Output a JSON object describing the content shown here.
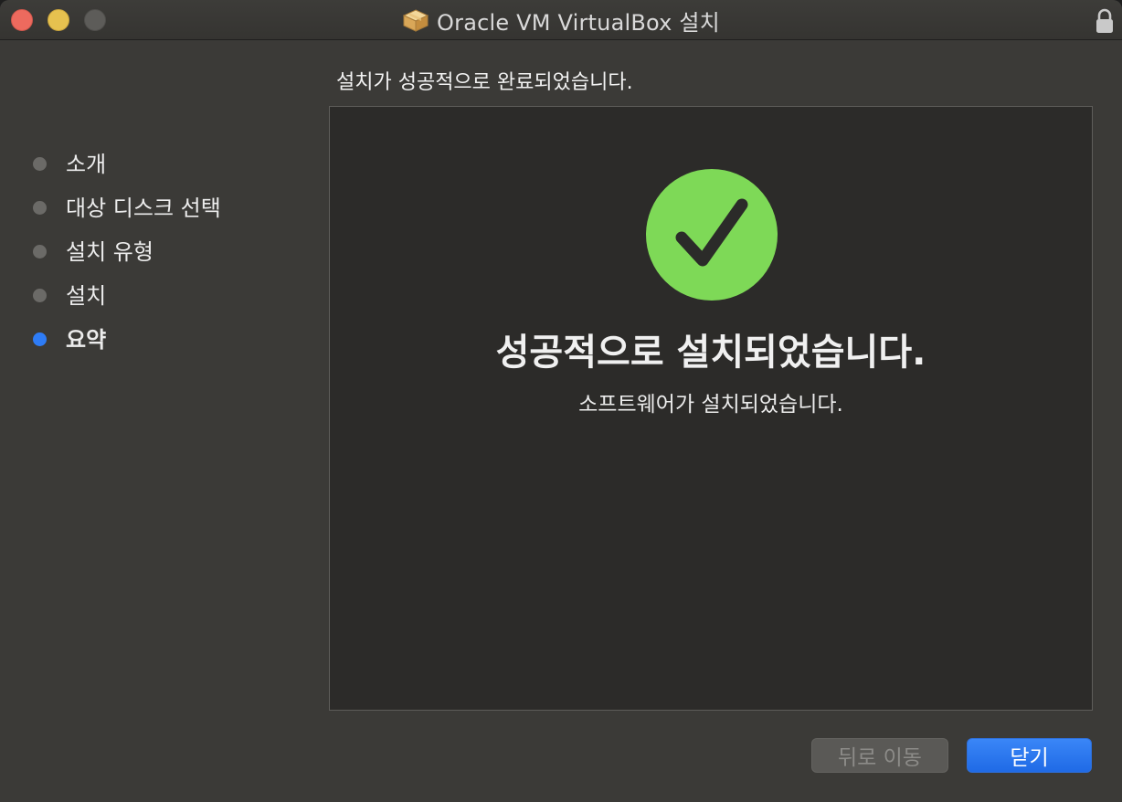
{
  "window": {
    "title": "Oracle VM VirtualBox 설치",
    "icon": "package-icon"
  },
  "sidebar": {
    "items": [
      {
        "label": "소개",
        "active": false
      },
      {
        "label": "대상 디스크 선택",
        "active": false
      },
      {
        "label": "설치 유형",
        "active": false
      },
      {
        "label": "설치",
        "active": false
      },
      {
        "label": "요약",
        "active": true
      }
    ]
  },
  "main": {
    "heading": "설치가 성공적으로 완료되었습니다.",
    "success_title": "성공적으로 설치되었습니다.",
    "success_subtitle": "소프트웨어가 설치되었습니다."
  },
  "buttons": {
    "back_label": "뒤로 이동",
    "close_label": "닫기"
  },
  "colors": {
    "accent": "#2e7cf6",
    "success": "#7ed957"
  }
}
